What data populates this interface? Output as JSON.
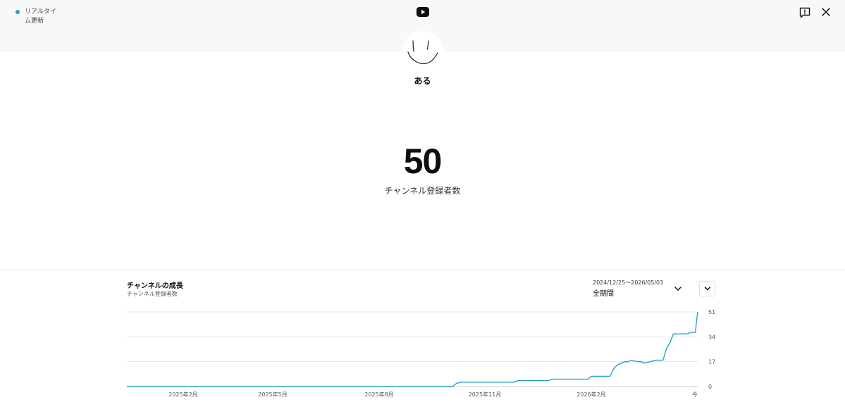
{
  "header": {
    "live_status": "リアルタイム更新",
    "logo_icon": "youtube-logo-icon",
    "feedback_icon": "feedback-icon",
    "close_icon": "close-icon"
  },
  "channel": {
    "name": "ある",
    "avatar_icon": "smiley-face-avatar"
  },
  "subscribers": {
    "count": "50",
    "label": "チャンネル登録者数"
  },
  "growth": {
    "title": "チャンネルの成長",
    "subtitle": "チャンネル登録者数",
    "date_range": "2024/12/25〜2026/05/03",
    "period": "全期間"
  },
  "colors": {
    "line": "#2aa3c8",
    "live_dot": "#22a3c6"
  },
  "chart_data": {
    "type": "line",
    "x_ticks": [
      "2025年2月",
      "2025年5月",
      "2025年8月",
      "2025年11月",
      "2026年2月",
      "今"
    ],
    "y_ticks": [
      0,
      17,
      34,
      51
    ],
    "ylim": [
      0,
      51
    ],
    "xlim": [
      "2024-12-25",
      "2026-05-03"
    ],
    "series": [
      {
        "x": [
          "2024-12-25",
          "2025-10-03",
          "2025-10-06",
          "2025-10-10",
          "2025-11-25",
          "2025-11-28",
          "2025-12-25",
          "2025-12-28",
          "2026-01-28",
          "2026-01-31",
          "2026-02-16",
          "2026-02-18",
          "2026-02-20",
          "2026-02-23",
          "2026-02-26",
          "2026-03-01",
          "2026-03-04",
          "2026-03-06",
          "2026-03-12",
          "2026-03-15",
          "2026-03-18",
          "2026-03-28",
          "2026-03-31",
          "2026-04-03",
          "2026-04-06",
          "2026-04-09",
          "2026-04-12",
          "2026-04-24",
          "2026-04-27",
          "2026-05-01",
          "2026-05-02",
          "2026-05-03"
        ],
        "y": [
          0,
          0,
          2,
          3,
          3,
          4,
          4,
          5,
          5,
          7,
          7,
          10,
          13,
          15,
          16,
          17,
          17,
          18,
          17,
          17,
          16,
          18,
          18,
          18,
          26,
          30,
          36,
          36,
          37,
          37,
          45,
          51
        ]
      }
    ]
  }
}
